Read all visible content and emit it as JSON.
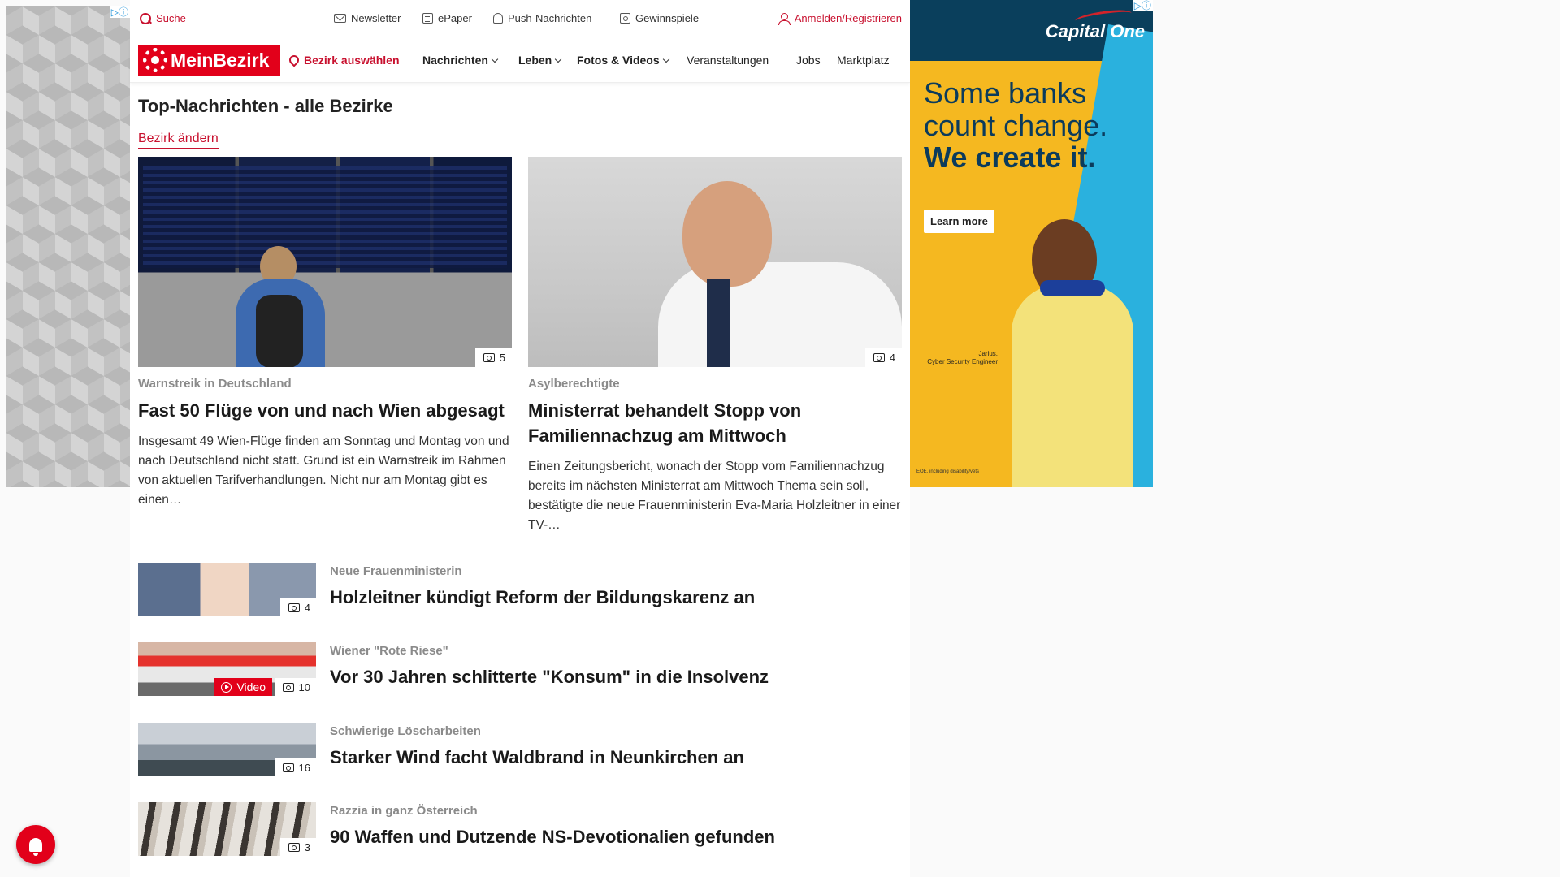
{
  "topbar": {
    "search": "Suche",
    "newsletter": "Newsletter",
    "epaper": "ePaper",
    "push": "Push-Nachrichten",
    "gewinnspiele": "Gewinnspiele",
    "login": "Anmelden/Registrieren"
  },
  "nav": {
    "logo": "MeinBezirk",
    "district": "Bezirk auswählen",
    "items": [
      "Nachrichten",
      "Leben",
      "Fotos & Videos",
      "Veranstaltungen",
      "Jobs",
      "Marktplatz"
    ]
  },
  "section": {
    "title": "Top-Nachrichten - alle Bezirke",
    "change": "Bezirk ändern"
  },
  "featured": [
    {
      "kicker": "Warnstreik in Deutschland",
      "headline": "Fast 50 Flüge von und nach Wien abgesagt",
      "teaser": "Insgesamt 49 Wien-Flüge finden am Sonntag und Montag von und nach Deutschland nicht statt. Grund ist ein Warnstreik im Rahmen von aktuellen Tarifverhandlungen. Nicht nur am Montag gibt es einen…",
      "photos": "5"
    },
    {
      "kicker": "Asylberechtigte",
      "headline": "Ministerrat behandelt Stopp von Familiennachzug am Mittwoch",
      "teaser": "Einen Zeitungsbericht, wonach der Stopp vom Familiennachzug bereits im nächsten Ministerrat am Mittwoch Thema sein soll, bestätigte die neue Frauenministerin Eva-Maria Holzleitner in einer TV-…",
      "photos": "4"
    }
  ],
  "list": [
    {
      "kicker": "Neue Frauenministerin",
      "headline": "Holzleitner kündigt Reform der Bildungskarenz an",
      "photos": "4"
    },
    {
      "kicker": "Wiener \"Rote Riese\"",
      "headline": "Vor 30 Jahren schlitterte \"Konsum\" in die Insolvenz",
      "photos": "10",
      "video": "Video"
    },
    {
      "kicker": "Schwierige Löscharbeiten",
      "headline": "Starker Wind facht Waldbrand in Neunkirchen an",
      "photos": "16"
    },
    {
      "kicker": "Razzia in ganz Österreich",
      "headline": "90 Waffen und Dutzende NS-Devotionalien gefunden",
      "photos": "3"
    }
  ],
  "ad_right": {
    "brand": "Capital One",
    "line1": "Some banks",
    "line2": "count change.",
    "line3": "We create it.",
    "cta": "Learn more",
    "caption_name": "Jarius,",
    "caption_role": "Cyber Security Engineer",
    "fine": "EOE, including disability/vets"
  },
  "colors": {
    "brand_red": "#e2001a",
    "accent_red": "#c8102e",
    "kicker_gray": "#8a8a8a"
  }
}
